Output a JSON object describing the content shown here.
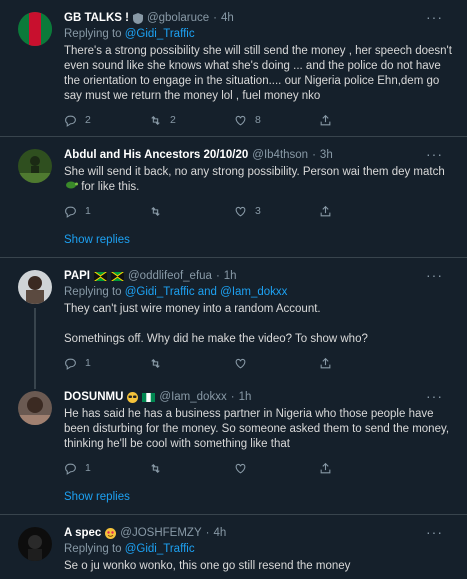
{
  "colors": {
    "background": "#15202b",
    "link": "#1da1f2",
    "muted": "#8899a6",
    "divider": "#38444d"
  },
  "tweets": [
    {
      "name": "GB TALKS !",
      "handle": "@gbolaruce",
      "time": "4h",
      "replying_prefix": "Replying to ",
      "replying_to": "@Gidi_Traffic",
      "text": "There's a strong possibility she will still send the money , her speech doesn't even sound like she knows what she's doing ... and the police do not have the orientation to engage in the situation.... our Nigeria police Ehn,dem go say must we return the money lol , fuel money nko",
      "replies": "2",
      "retweets": "2",
      "likes": "8"
    },
    {
      "name": "Abdul and His Ancestors 20/10/20",
      "handle": "@Ib4thson",
      "time": "3h",
      "text": "She will send it back, no any strong possibility. Person wai them dey match",
      "text_tail": " for like this.",
      "replies": "1",
      "retweets": "",
      "likes": "3"
    },
    {
      "name": "PAPI",
      "handle": "@oddlifeof_efua",
      "time": "1h",
      "replying_prefix": "Replying to ",
      "replying_to": "@Gidi_Traffic and @Iam_dokxx",
      "text": "They can't just wire money into a random Account.\n\nSomethings off. Why did he make the video? To show who?",
      "replies": "1",
      "retweets": "",
      "likes": ""
    },
    {
      "name": "DOSUNMU",
      "handle": "@Iam_dokxx",
      "time": "1h",
      "text": "He has said he has a business partner in Nigeria who those people have been disturbing for the money. So someone asked them to send the money, thinking he'll be cool with something like that",
      "replies": "1",
      "retweets": "",
      "likes": ""
    },
    {
      "name": "A spec",
      "handle": "@JOSHFEMZY",
      "time": "4h",
      "replying_prefix": "Replying to ",
      "replying_to": "@Gidi_Traffic",
      "text": "Se o ju wonko wonko, this one go still resend the money"
    }
  ],
  "show_replies": "Show replies",
  "more_glyph": "···",
  "icons": [
    "reply-icon",
    "retweet-icon",
    "like-icon",
    "share-icon",
    "more-icon",
    "verified-badge-icon"
  ]
}
